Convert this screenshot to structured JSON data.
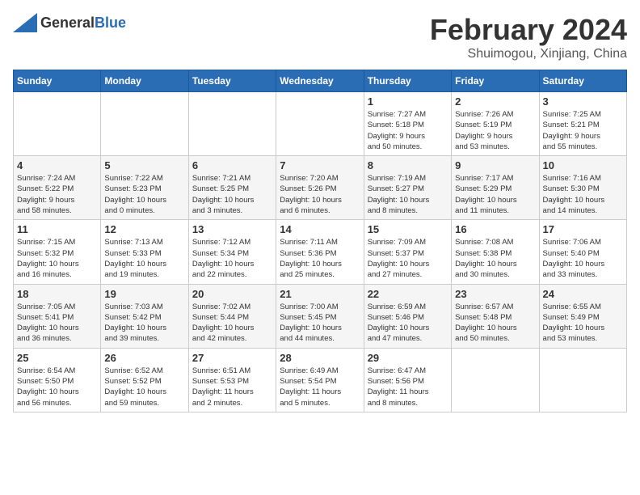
{
  "header": {
    "logo": {
      "general": "General",
      "blue": "Blue"
    },
    "title": "February 2024",
    "location": "Shuimogou, Xinjiang, China"
  },
  "weekdays": [
    "Sunday",
    "Monday",
    "Tuesday",
    "Wednesday",
    "Thursday",
    "Friday",
    "Saturday"
  ],
  "weeks": [
    [
      {
        "day": "",
        "info": ""
      },
      {
        "day": "",
        "info": ""
      },
      {
        "day": "",
        "info": ""
      },
      {
        "day": "",
        "info": ""
      },
      {
        "day": "1",
        "info": "Sunrise: 7:27 AM\nSunset: 5:18 PM\nDaylight: 9 hours\nand 50 minutes."
      },
      {
        "day": "2",
        "info": "Sunrise: 7:26 AM\nSunset: 5:19 PM\nDaylight: 9 hours\nand 53 minutes."
      },
      {
        "day": "3",
        "info": "Sunrise: 7:25 AM\nSunset: 5:21 PM\nDaylight: 9 hours\nand 55 minutes."
      }
    ],
    [
      {
        "day": "4",
        "info": "Sunrise: 7:24 AM\nSunset: 5:22 PM\nDaylight: 9 hours\nand 58 minutes."
      },
      {
        "day": "5",
        "info": "Sunrise: 7:22 AM\nSunset: 5:23 PM\nDaylight: 10 hours\nand 0 minutes."
      },
      {
        "day": "6",
        "info": "Sunrise: 7:21 AM\nSunset: 5:25 PM\nDaylight: 10 hours\nand 3 minutes."
      },
      {
        "day": "7",
        "info": "Sunrise: 7:20 AM\nSunset: 5:26 PM\nDaylight: 10 hours\nand 6 minutes."
      },
      {
        "day": "8",
        "info": "Sunrise: 7:19 AM\nSunset: 5:27 PM\nDaylight: 10 hours\nand 8 minutes."
      },
      {
        "day": "9",
        "info": "Sunrise: 7:17 AM\nSunset: 5:29 PM\nDaylight: 10 hours\nand 11 minutes."
      },
      {
        "day": "10",
        "info": "Sunrise: 7:16 AM\nSunset: 5:30 PM\nDaylight: 10 hours\nand 14 minutes."
      }
    ],
    [
      {
        "day": "11",
        "info": "Sunrise: 7:15 AM\nSunset: 5:32 PM\nDaylight: 10 hours\nand 16 minutes."
      },
      {
        "day": "12",
        "info": "Sunrise: 7:13 AM\nSunset: 5:33 PM\nDaylight: 10 hours\nand 19 minutes."
      },
      {
        "day": "13",
        "info": "Sunrise: 7:12 AM\nSunset: 5:34 PM\nDaylight: 10 hours\nand 22 minutes."
      },
      {
        "day": "14",
        "info": "Sunrise: 7:11 AM\nSunset: 5:36 PM\nDaylight: 10 hours\nand 25 minutes."
      },
      {
        "day": "15",
        "info": "Sunrise: 7:09 AM\nSunset: 5:37 PM\nDaylight: 10 hours\nand 27 minutes."
      },
      {
        "day": "16",
        "info": "Sunrise: 7:08 AM\nSunset: 5:38 PM\nDaylight: 10 hours\nand 30 minutes."
      },
      {
        "day": "17",
        "info": "Sunrise: 7:06 AM\nSunset: 5:40 PM\nDaylight: 10 hours\nand 33 minutes."
      }
    ],
    [
      {
        "day": "18",
        "info": "Sunrise: 7:05 AM\nSunset: 5:41 PM\nDaylight: 10 hours\nand 36 minutes."
      },
      {
        "day": "19",
        "info": "Sunrise: 7:03 AM\nSunset: 5:42 PM\nDaylight: 10 hours\nand 39 minutes."
      },
      {
        "day": "20",
        "info": "Sunrise: 7:02 AM\nSunset: 5:44 PM\nDaylight: 10 hours\nand 42 minutes."
      },
      {
        "day": "21",
        "info": "Sunrise: 7:00 AM\nSunset: 5:45 PM\nDaylight: 10 hours\nand 44 minutes."
      },
      {
        "day": "22",
        "info": "Sunrise: 6:59 AM\nSunset: 5:46 PM\nDaylight: 10 hours\nand 47 minutes."
      },
      {
        "day": "23",
        "info": "Sunrise: 6:57 AM\nSunset: 5:48 PM\nDaylight: 10 hours\nand 50 minutes."
      },
      {
        "day": "24",
        "info": "Sunrise: 6:55 AM\nSunset: 5:49 PM\nDaylight: 10 hours\nand 53 minutes."
      }
    ],
    [
      {
        "day": "25",
        "info": "Sunrise: 6:54 AM\nSunset: 5:50 PM\nDaylight: 10 hours\nand 56 minutes."
      },
      {
        "day": "26",
        "info": "Sunrise: 6:52 AM\nSunset: 5:52 PM\nDaylight: 10 hours\nand 59 minutes."
      },
      {
        "day": "27",
        "info": "Sunrise: 6:51 AM\nSunset: 5:53 PM\nDaylight: 11 hours\nand 2 minutes."
      },
      {
        "day": "28",
        "info": "Sunrise: 6:49 AM\nSunset: 5:54 PM\nDaylight: 11 hours\nand 5 minutes."
      },
      {
        "day": "29",
        "info": "Sunrise: 6:47 AM\nSunset: 5:56 PM\nDaylight: 11 hours\nand 8 minutes."
      },
      {
        "day": "",
        "info": ""
      },
      {
        "day": "",
        "info": ""
      }
    ]
  ]
}
